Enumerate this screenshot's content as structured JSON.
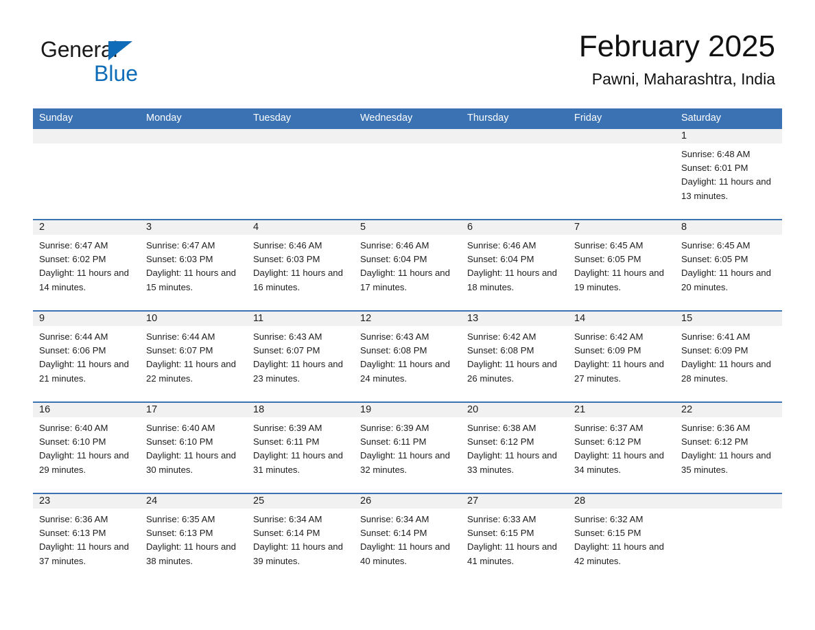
{
  "brand": {
    "name_part1": "General",
    "name_part2": "Blue",
    "accent_color": "#0f6cb8",
    "triangle_icon": "triangle-icon"
  },
  "header": {
    "title": "February 2025",
    "subtitle": "Pawni, Maharashtra, India"
  },
  "calendar": {
    "header_bg_color": "#3a72b4",
    "row_divider_color": "#3a72b4",
    "day_strip_bg_color": "#f1f1f1",
    "weekdays": [
      "Sunday",
      "Monday",
      "Tuesday",
      "Wednesday",
      "Thursday",
      "Friday",
      "Saturday"
    ],
    "weeks": [
      [
        {
          "day": "",
          "sunrise": "",
          "sunset": "",
          "daylight": ""
        },
        {
          "day": "",
          "sunrise": "",
          "sunset": "",
          "daylight": ""
        },
        {
          "day": "",
          "sunrise": "",
          "sunset": "",
          "daylight": ""
        },
        {
          "day": "",
          "sunrise": "",
          "sunset": "",
          "daylight": ""
        },
        {
          "day": "",
          "sunrise": "",
          "sunset": "",
          "daylight": ""
        },
        {
          "day": "",
          "sunrise": "",
          "sunset": "",
          "daylight": ""
        },
        {
          "day": "1",
          "sunrise": "Sunrise: 6:48 AM",
          "sunset": "Sunset: 6:01 PM",
          "daylight": "Daylight: 11 hours and 13 minutes."
        }
      ],
      [
        {
          "day": "2",
          "sunrise": "Sunrise: 6:47 AM",
          "sunset": "Sunset: 6:02 PM",
          "daylight": "Daylight: 11 hours and 14 minutes."
        },
        {
          "day": "3",
          "sunrise": "Sunrise: 6:47 AM",
          "sunset": "Sunset: 6:03 PM",
          "daylight": "Daylight: 11 hours and 15 minutes."
        },
        {
          "day": "4",
          "sunrise": "Sunrise: 6:46 AM",
          "sunset": "Sunset: 6:03 PM",
          "daylight": "Daylight: 11 hours and 16 minutes."
        },
        {
          "day": "5",
          "sunrise": "Sunrise: 6:46 AM",
          "sunset": "Sunset: 6:04 PM",
          "daylight": "Daylight: 11 hours and 17 minutes."
        },
        {
          "day": "6",
          "sunrise": "Sunrise: 6:46 AM",
          "sunset": "Sunset: 6:04 PM",
          "daylight": "Daylight: 11 hours and 18 minutes."
        },
        {
          "day": "7",
          "sunrise": "Sunrise: 6:45 AM",
          "sunset": "Sunset: 6:05 PM",
          "daylight": "Daylight: 11 hours and 19 minutes."
        },
        {
          "day": "8",
          "sunrise": "Sunrise: 6:45 AM",
          "sunset": "Sunset: 6:05 PM",
          "daylight": "Daylight: 11 hours and 20 minutes."
        }
      ],
      [
        {
          "day": "9",
          "sunrise": "Sunrise: 6:44 AM",
          "sunset": "Sunset: 6:06 PM",
          "daylight": "Daylight: 11 hours and 21 minutes."
        },
        {
          "day": "10",
          "sunrise": "Sunrise: 6:44 AM",
          "sunset": "Sunset: 6:07 PM",
          "daylight": "Daylight: 11 hours and 22 minutes."
        },
        {
          "day": "11",
          "sunrise": "Sunrise: 6:43 AM",
          "sunset": "Sunset: 6:07 PM",
          "daylight": "Daylight: 11 hours and 23 minutes."
        },
        {
          "day": "12",
          "sunrise": "Sunrise: 6:43 AM",
          "sunset": "Sunset: 6:08 PM",
          "daylight": "Daylight: 11 hours and 24 minutes."
        },
        {
          "day": "13",
          "sunrise": "Sunrise: 6:42 AM",
          "sunset": "Sunset: 6:08 PM",
          "daylight": "Daylight: 11 hours and 26 minutes."
        },
        {
          "day": "14",
          "sunrise": "Sunrise: 6:42 AM",
          "sunset": "Sunset: 6:09 PM",
          "daylight": "Daylight: 11 hours and 27 minutes."
        },
        {
          "day": "15",
          "sunrise": "Sunrise: 6:41 AM",
          "sunset": "Sunset: 6:09 PM",
          "daylight": "Daylight: 11 hours and 28 minutes."
        }
      ],
      [
        {
          "day": "16",
          "sunrise": "Sunrise: 6:40 AM",
          "sunset": "Sunset: 6:10 PM",
          "daylight": "Daylight: 11 hours and 29 minutes."
        },
        {
          "day": "17",
          "sunrise": "Sunrise: 6:40 AM",
          "sunset": "Sunset: 6:10 PM",
          "daylight": "Daylight: 11 hours and 30 minutes."
        },
        {
          "day": "18",
          "sunrise": "Sunrise: 6:39 AM",
          "sunset": "Sunset: 6:11 PM",
          "daylight": "Daylight: 11 hours and 31 minutes."
        },
        {
          "day": "19",
          "sunrise": "Sunrise: 6:39 AM",
          "sunset": "Sunset: 6:11 PM",
          "daylight": "Daylight: 11 hours and 32 minutes."
        },
        {
          "day": "20",
          "sunrise": "Sunrise: 6:38 AM",
          "sunset": "Sunset: 6:12 PM",
          "daylight": "Daylight: 11 hours and 33 minutes."
        },
        {
          "day": "21",
          "sunrise": "Sunrise: 6:37 AM",
          "sunset": "Sunset: 6:12 PM",
          "daylight": "Daylight: 11 hours and 34 minutes."
        },
        {
          "day": "22",
          "sunrise": "Sunrise: 6:36 AM",
          "sunset": "Sunset: 6:12 PM",
          "daylight": "Daylight: 11 hours and 35 minutes."
        }
      ],
      [
        {
          "day": "23",
          "sunrise": "Sunrise: 6:36 AM",
          "sunset": "Sunset: 6:13 PM",
          "daylight": "Daylight: 11 hours and 37 minutes."
        },
        {
          "day": "24",
          "sunrise": "Sunrise: 6:35 AM",
          "sunset": "Sunset: 6:13 PM",
          "daylight": "Daylight: 11 hours and 38 minutes."
        },
        {
          "day": "25",
          "sunrise": "Sunrise: 6:34 AM",
          "sunset": "Sunset: 6:14 PM",
          "daylight": "Daylight: 11 hours and 39 minutes."
        },
        {
          "day": "26",
          "sunrise": "Sunrise: 6:34 AM",
          "sunset": "Sunset: 6:14 PM",
          "daylight": "Daylight: 11 hours and 40 minutes."
        },
        {
          "day": "27",
          "sunrise": "Sunrise: 6:33 AM",
          "sunset": "Sunset: 6:15 PM",
          "daylight": "Daylight: 11 hours and 41 minutes."
        },
        {
          "day": "28",
          "sunrise": "Sunrise: 6:32 AM",
          "sunset": "Sunset: 6:15 PM",
          "daylight": "Daylight: 11 hours and 42 minutes."
        },
        {
          "day": "",
          "sunrise": "",
          "sunset": "",
          "daylight": ""
        }
      ]
    ]
  }
}
